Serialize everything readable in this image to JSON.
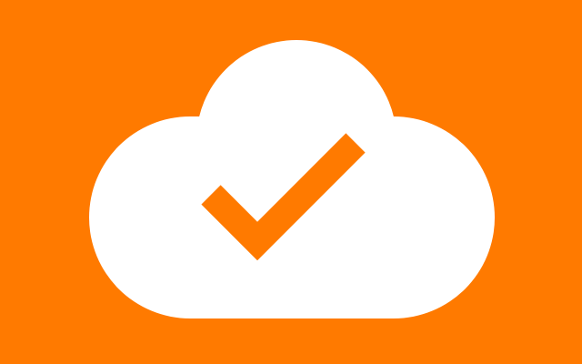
{
  "colors": {
    "background": "#FF7A00",
    "cloud": "#FFFFFF",
    "check": "#FF7A00"
  },
  "icons": {
    "cloud": "cloud-icon",
    "check": "checkmark-icon"
  }
}
